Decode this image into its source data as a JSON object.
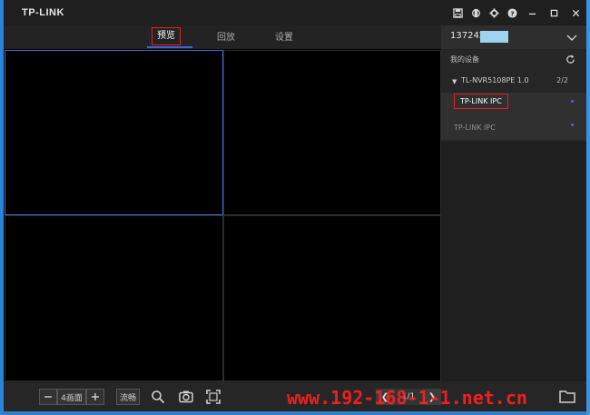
{
  "window": {
    "logo": "TP-LINK"
  },
  "tabs": [
    {
      "label": "预览",
      "active": true
    },
    {
      "label": "回放",
      "active": false
    },
    {
      "label": "设置",
      "active": false
    }
  ],
  "account": {
    "number": "137242"
  },
  "devices": {
    "section_title": "我的设备",
    "nvr_name": "TL-NVR5108PE 1.0",
    "nvr_count": "2/2",
    "cameras": [
      {
        "name": "TP-LINK IPC",
        "highlighted": true
      },
      {
        "name": "TP-LINK IPC",
        "highlighted": false
      }
    ]
  },
  "bottombar": {
    "layout_label": "4画面",
    "stream_label": "流畅",
    "page": "1/1"
  },
  "watermark": "www.192-168-1-1.net.cn",
  "icons": {
    "titlebar": [
      "save-icon",
      "gear-icon",
      "settings-icon",
      "help-icon"
    ],
    "window_controls": [
      "minimize-icon",
      "maximize-icon",
      "close-icon"
    ]
  },
  "colors": {
    "accent": "#3a66d8",
    "highlight_border": "#e02020",
    "selected_cell_border": "#4a67d0",
    "online_dot": "#4a6be0"
  }
}
